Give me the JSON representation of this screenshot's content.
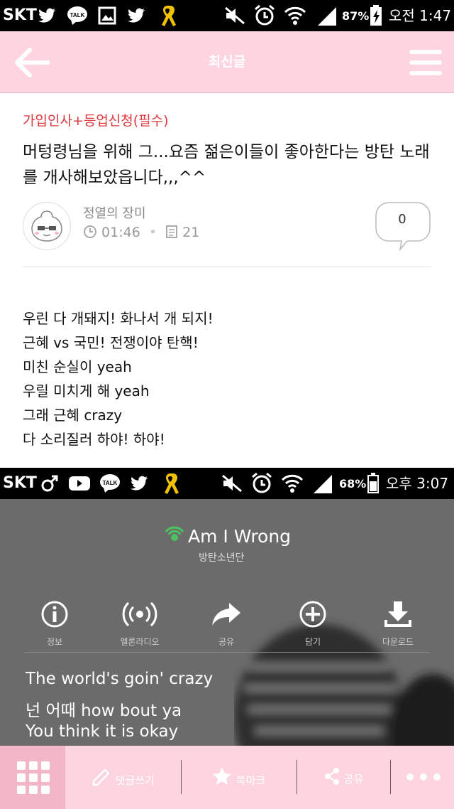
{
  "status_bar": {
    "carrier": "SKT",
    "battery": "87%",
    "time": "오전 1:47",
    "icons": [
      "twitter-icon",
      "kakaotalk-icon",
      "image-icon",
      "twitter-icon",
      "yellow-ribbon-icon",
      "mute-icon",
      "alarm-icon",
      "wifi-icon",
      "signal-icon",
      "battery-charging-icon"
    ]
  },
  "header": {
    "title": "최신글",
    "back_icon": "arrow-left-icon",
    "menu_icon": "hamburger-icon"
  },
  "post": {
    "category": "가입인사+등업신청(필수)",
    "title": "머텅령님을 위해 그...요즘 젊은이들이 좋아한다는 방탄 노래를 개사해보았읍니다,,,^^",
    "author": "정열의 장미",
    "time": "01:46",
    "views": "21",
    "comment_count": "0",
    "lyrics": [
      "우린 다 개돼지! 화나서 개 되지!",
      "근혜 vs 국민! 전쟁이야 탄핵!",
      "미친 순실이 yeah",
      "우릴 미치게 해 yeah",
      "그래 근혜 crazy",
      "다 소리질러 하야! 하야!"
    ]
  },
  "embedded_screenshot": {
    "status_bar": {
      "carrier": "SKT",
      "battery": "68%",
      "time": "오후 3:07"
    },
    "song_title": "Am I Wrong",
    "artist": "방탄소년단",
    "actions": [
      {
        "label": "정보",
        "icon": "info-icon"
      },
      {
        "label": "멜론라디오",
        "icon": "radio-icon"
      },
      {
        "label": "공유",
        "icon": "share-arrow-icon"
      },
      {
        "label": "담기",
        "icon": "plus-circle-icon"
      },
      {
        "label": "다운로드",
        "icon": "download-icon"
      }
    ],
    "lyrics": [
      "The world's goin' crazy",
      "넌 어때 how bout ya",
      "You think it is okay"
    ]
  },
  "bottom_bar": {
    "comment_label": "댓글쓰기",
    "bookmark_label": "북마크",
    "share_label": "공유",
    "more_icon": "more-dots-icon"
  },
  "colors": {
    "header_bg": "#fdd5e0",
    "category": "#e0373f",
    "grid_btn_bg": "#f2b6c6"
  }
}
